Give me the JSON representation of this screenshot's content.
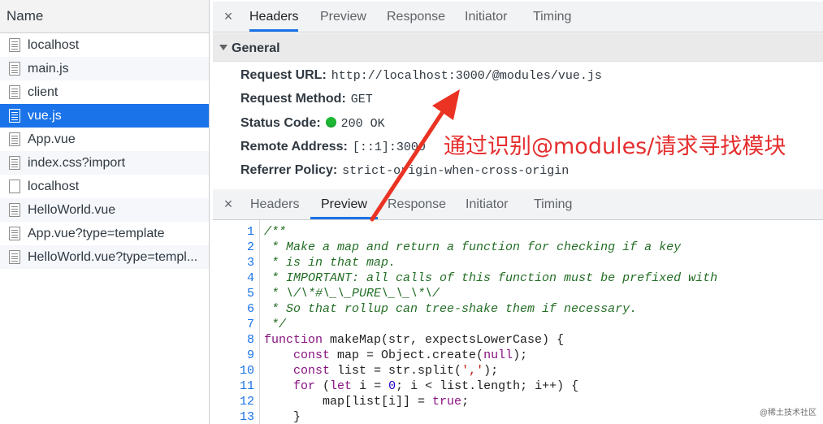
{
  "left_panel": {
    "header": "Name",
    "requests": [
      {
        "name": "localhost",
        "icon": "document-icon"
      },
      {
        "name": "main.js",
        "icon": "document-icon"
      },
      {
        "name": "client",
        "icon": "document-icon"
      },
      {
        "name": "vue.js",
        "icon": "document-icon"
      },
      {
        "name": "App.vue",
        "icon": "document-icon"
      },
      {
        "name": "index.css?import",
        "icon": "document-icon"
      },
      {
        "name": "localhost",
        "icon": "blank-document-icon"
      },
      {
        "name": "HelloWorld.vue",
        "icon": "document-icon"
      },
      {
        "name": "App.vue?type=template",
        "icon": "document-icon"
      },
      {
        "name": "HelloWorld.vue?type=templ...",
        "icon": "document-icon"
      }
    ]
  },
  "top_tabs": {
    "close": "×",
    "tabs": [
      "Headers",
      "Preview",
      "Response",
      "Initiator",
      "Timing"
    ],
    "active": "Headers"
  },
  "general": {
    "title": "General",
    "request_url_label": "Request URL:",
    "request_url": "http://localhost:3000/@modules/vue.js",
    "request_method_label": "Request Method:",
    "request_method": "GET",
    "status_code_label": "Status Code:",
    "status_code": "200 OK",
    "status_color": "#1db833",
    "remote_address_label": "Remote Address:",
    "remote_address": "[::1]:3000",
    "referrer_policy_label": "Referrer Policy:",
    "referrer_policy": "strict-origin-when-cross-origin"
  },
  "bottom_tabs": {
    "close": "×",
    "tabs": [
      "Headers",
      "Preview",
      "Response",
      "Initiator",
      "Timing"
    ],
    "active": "Preview"
  },
  "code": {
    "line_numbers": [
      "1",
      "2",
      "3",
      "4",
      "5",
      "6",
      "7",
      "8",
      "9",
      "10",
      "11",
      "12",
      "13"
    ],
    "lines": [
      "/**",
      " * Make a map and return a function for checking if a key",
      " * is in that map.",
      " * IMPORTANT: all calls of this function must be prefixed with",
      " * \\/\\*#\\_\\_PURE\\_\\_\\*\\/",
      " * So that rollup can tree-shake them if necessary.",
      " */",
      "function makeMap(str, expectsLowerCase) {",
      "    const map = Object.create(null);",
      "    const list = str.split(',');",
      "    for (let i = 0; i < list.length; i++) {",
      "        map[list[i]] = true;",
      "    }"
    ]
  },
  "annotation": {
    "text": "通过识别@modules/请求寻找模块",
    "color": "#e52e2e"
  },
  "watermark": "@稀土技术社区",
  "colors": {
    "selected_row": "#1a73e8",
    "active_tab_underline": "#1a73e8"
  }
}
